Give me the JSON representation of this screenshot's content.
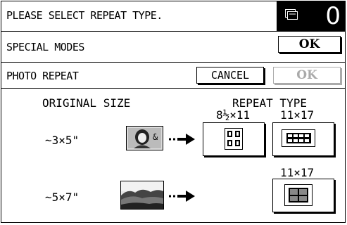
{
  "message": "PLEASE SELECT REPEAT TYPE.",
  "copy_count": "0",
  "special_modes": {
    "title": "SPECIAL MODES",
    "ok_label": "OK"
  },
  "photo_repeat": {
    "title": "PHOTO REPEAT",
    "cancel_label": "CANCEL",
    "ok_label": "OK"
  },
  "headers": {
    "original_size": "ORIGINAL SIZE",
    "repeat_type": "REPEAT TYPE"
  },
  "paper_sizes": {
    "letter": "8½×11",
    "tabloid_row1": "11×17",
    "tabloid_row2": "11×17"
  },
  "originals": [
    {
      "size": "~3×5\"",
      "icon": "portrait-photo-icon"
    },
    {
      "size": "~5×7\"",
      "icon": "landscape-photo-icon"
    }
  ]
}
